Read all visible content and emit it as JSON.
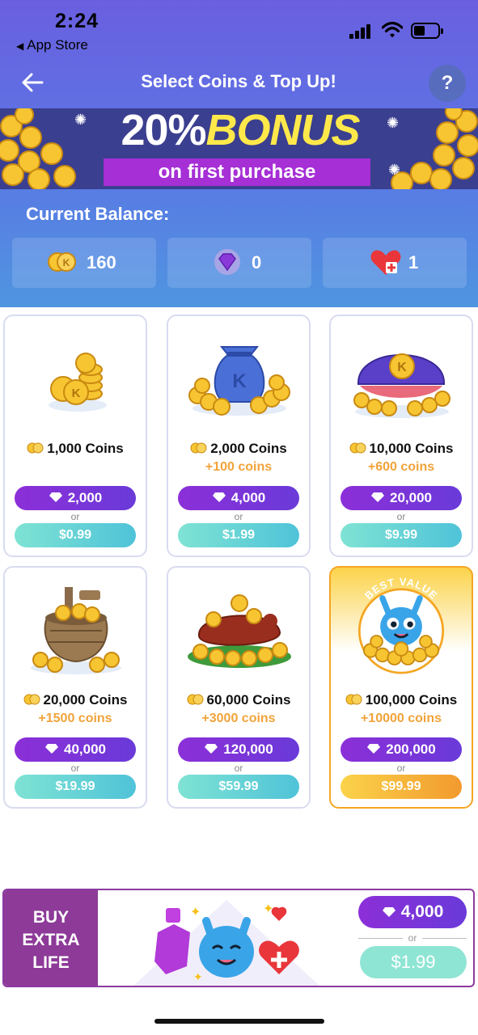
{
  "status": {
    "time": "2:24",
    "back_app": "App Store"
  },
  "nav": {
    "title": "Select Coins & Top Up!",
    "help": "?"
  },
  "banner": {
    "pct": "20%",
    "bonus": "BONUS",
    "subtitle": "on first purchase"
  },
  "balance": {
    "label": "Current Balance:",
    "coins": "160",
    "gems": "0",
    "lives": "1"
  },
  "packs": [
    {
      "title": "1,000 Coins",
      "bonus": "",
      "gems": "2,000",
      "or": "or",
      "price": "$0.99"
    },
    {
      "title": "2,000 Coins",
      "bonus": "+100 coins",
      "gems": "4,000",
      "or": "or",
      "price": "$1.99"
    },
    {
      "title": "10,000 Coins",
      "bonus": "+600 coins",
      "gems": "20,000",
      "or": "or",
      "price": "$9.99"
    },
    {
      "title": "20,000 Coins",
      "bonus": "+1500 coins",
      "gems": "40,000",
      "or": "or",
      "price": "$19.99"
    },
    {
      "title": "60,000 Coins",
      "bonus": "+3000 coins",
      "gems": "120,000",
      "or": "or",
      "price": "$59.99"
    },
    {
      "title": "100,000 Coins",
      "bonus": "+10000 coins",
      "gems": "200,000",
      "or": "or",
      "price": "$99.99",
      "ribbon": "BEST VALUE"
    }
  ],
  "extra_life": {
    "label_line1": "BUY",
    "label_line2": "EXTRA",
    "label_line3": "LIFE",
    "gems": "4,000",
    "or": "or",
    "price": "$1.99"
  },
  "colors": {
    "header_top": "#6a5fe0",
    "header_bottom": "#4f95e0",
    "gem_button": "#7a34d8",
    "cash_button": "#5fd0d6",
    "best_value": "#f5a623",
    "bonus_text": "#f2a33a",
    "extra_life_panel": "#8d3a98"
  }
}
